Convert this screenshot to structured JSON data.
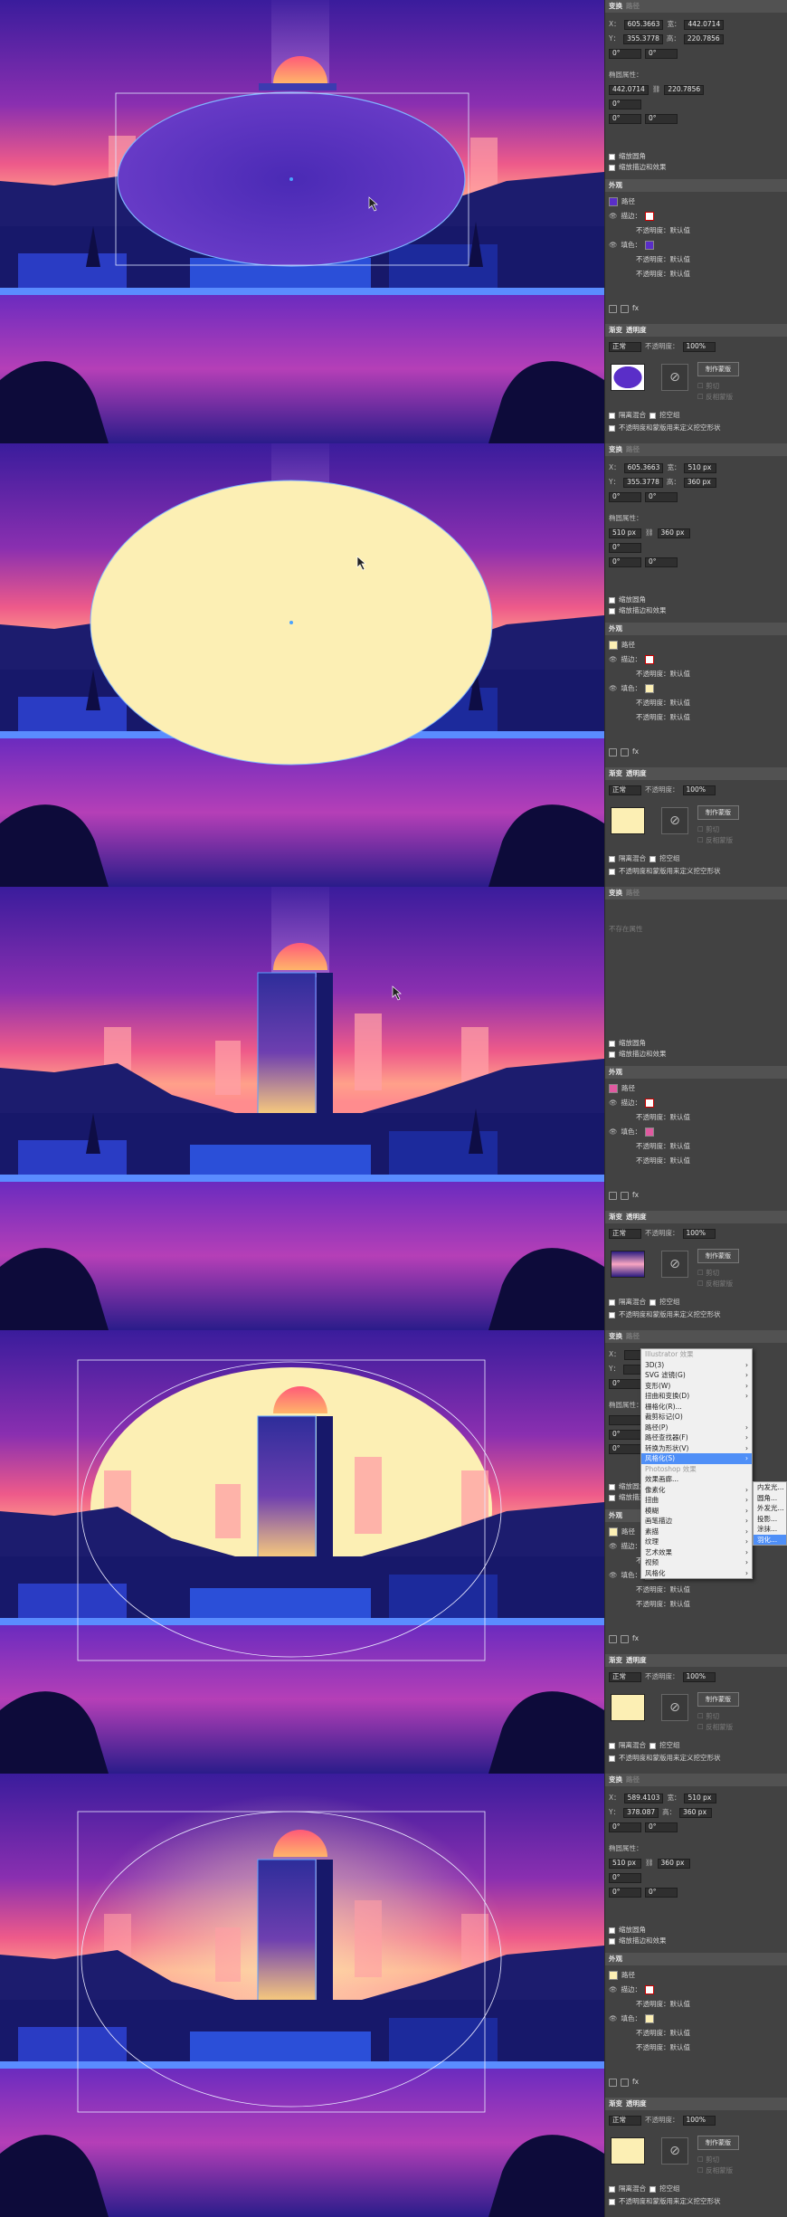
{
  "colors": {
    "sky_top": "#3a1f9e",
    "sky_mid": "#e8508a",
    "sky_glow": "#ff9a8a",
    "ground": "#1b1a6e",
    "road": "#5a2aa8",
    "moon": "#fcefb4",
    "sun_top": "#ff6a5a",
    "tower": "#2b2aa0",
    "panel_bg": "#424242",
    "highlight": "#4f8ff7"
  },
  "panel": {
    "tabs": [
      "变换",
      "路径"
    ],
    "x_value": "605.3663",
    "y_value": "355.3778",
    "w_value": "442.0714",
    "h_value": "220.7856",
    "angle1": "0°",
    "angle2": "0°",
    "shape_props_label": "椭圆属性：",
    "shape_w": "442.0714",
    "shape_h": "220.7856",
    "scale_corners": "缩放圆角",
    "scale_strokes": "缩放描边和效果",
    "appearance_title": "外观",
    "path_label": "路径",
    "stroke_label": "描边：",
    "opacity_default": "不透明度：默认值",
    "fill_label": "填色：",
    "fx_label": "fx",
    "transparency_tabs": [
      "渐变",
      "透明度"
    ],
    "blend_mode": "正常",
    "opacity_label": "不透明度：",
    "opacity_value": "100%",
    "make_mask": "制作蒙版",
    "clip": "剪切",
    "invert_mask": "反相蒙版",
    "isolate_blend": "隔离混合",
    "knockout_group": "挖空组",
    "opacity_knockout": "不透明度和蒙版用来定义挖空形状"
  },
  "frames": [
    {
      "x": "605.3663",
      "y": "355.3778",
      "w": "442.0714",
      "h": "220.7856",
      "sw": "442.0714",
      "sh": "220.7856"
    },
    {
      "x": "605.3663",
      "y": "355.3778",
      "w": "510 px",
      "h": "360 px",
      "sw": "510 px",
      "sh": "360 px"
    },
    {
      "x": "",
      "y": "",
      "w": "",
      "h": "",
      "sw": "",
      "sh": ""
    },
    {
      "x": "",
      "y": "",
      "w": "",
      "h": "",
      "sw": "",
      "sh": ""
    },
    {
      "x": "589.4103",
      "y": "378.087",
      "w": "510 px",
      "h": "360 px",
      "sw": "510 px",
      "sh": "360 px"
    }
  ],
  "frame3_empty": "不存在属性",
  "frame5_path_label": "路径",
  "effect_menu": {
    "items": [
      {
        "label": "Illustrator 效果",
        "header": true
      },
      {
        "label": "3D(3)",
        "arrow": true
      },
      {
        "label": "SVG 滤镜(G)",
        "arrow": true
      },
      {
        "label": "变形(W)",
        "arrow": true
      },
      {
        "label": "扭曲和变换(D)",
        "arrow": true
      },
      {
        "label": "栅格化(R)..."
      },
      {
        "label": "裁剪标记(O)"
      },
      {
        "label": "路径(P)",
        "arrow": true
      },
      {
        "label": "路径查找器(F)",
        "arrow": true
      },
      {
        "label": "转换为形状(V)",
        "arrow": true
      },
      {
        "label": "风格化(S)",
        "arrow": true,
        "hl": true
      },
      {
        "label": "Photoshop 效果",
        "header": true
      },
      {
        "label": "效果画廊..."
      },
      {
        "label": "像素化",
        "arrow": true
      },
      {
        "label": "扭曲",
        "arrow": true
      },
      {
        "label": "模糊",
        "arrow": true
      },
      {
        "label": "画笔描边",
        "arrow": true
      },
      {
        "label": "素描",
        "arrow": true
      },
      {
        "label": "纹理",
        "arrow": true
      },
      {
        "label": "艺术效果",
        "arrow": true
      },
      {
        "label": "视频",
        "arrow": true
      },
      {
        "label": "风格化",
        "arrow": true
      }
    ],
    "submenu": [
      {
        "label": "内发光..."
      },
      {
        "label": "圆角..."
      },
      {
        "label": "外发光..."
      },
      {
        "label": "投影..."
      },
      {
        "label": "涂抹..."
      },
      {
        "label": "羽化...",
        "hl": true
      }
    ]
  }
}
